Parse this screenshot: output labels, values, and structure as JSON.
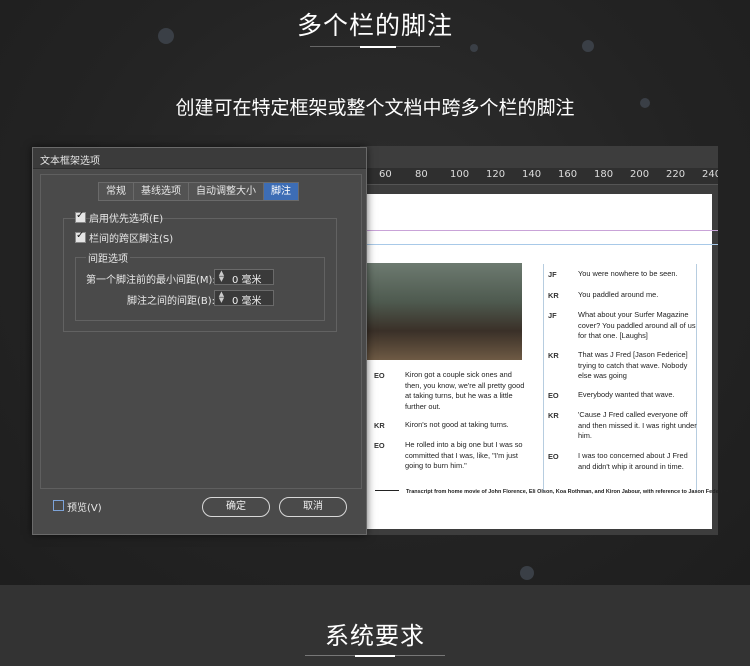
{
  "page": {
    "title": "多个栏的脚注",
    "subtitle": "创建可在特定框架或整个文档中跨多个栏的脚注",
    "section_title": "系统要求"
  },
  "ruler": {
    "ticks": [
      "60",
      "80",
      "100",
      "120",
      "140",
      "160",
      "180",
      "200",
      "220",
      "240"
    ]
  },
  "dialog": {
    "title": "文本框架选项",
    "tabs": [
      {
        "label": "常规",
        "active": false
      },
      {
        "label": "基线选项",
        "active": false
      },
      {
        "label": "自动调整大小",
        "active": false
      },
      {
        "label": "脚注",
        "active": true
      }
    ],
    "enable_override_label": "启用优先选项(E)",
    "enable_override_checked": true,
    "span_columns_label": "栏间的跨区脚注(S)",
    "span_columns_checked": true,
    "spacing_group_label": "间距选项",
    "min_space_label": "第一个脚注前的最小间距(M):",
    "min_space_value": "0 毫米",
    "space_between_label": "脚注之间的间距(B):",
    "space_between_value": "0 毫米",
    "preview_label": "预览(V)",
    "preview_checked": false,
    "ok_label": "确定",
    "cancel_label": "取消"
  },
  "document": {
    "left_column": [
      {
        "speaker": "EO",
        "text": "Kiron got a couple sick ones and then, you know, we're all pretty good at taking turns, but he was a little further out."
      },
      {
        "speaker": "KR",
        "text": "Kiron's not good at taking turns."
      },
      {
        "speaker": "EO",
        "text": "He rolled into a big one but I was so committed that I was, like, \"I'm just going to burn him.\""
      }
    ],
    "right_column": [
      {
        "speaker": "JF",
        "text": "You were nowhere to be seen."
      },
      {
        "speaker": "KR",
        "text": "You paddled around me."
      },
      {
        "speaker": "JF",
        "text": "What about your Surfer Magazine cover? You paddled around all of us for that one. [Laughs]"
      },
      {
        "speaker": "KR",
        "text": "That was J Fred [Jason Federice] trying to catch that wave. Nobody else was going"
      },
      {
        "speaker": "EO",
        "text": "Everybody wanted that wave."
      },
      {
        "speaker": "KR",
        "text": "'Cause J Fred called everyone off and then missed it. I was right under him."
      },
      {
        "speaker": "EO",
        "text": "I was too concerned about J Fred and didn't whip it around in time."
      }
    ],
    "footnote": "Transcript from home movie of John Florence, Eli Olson, Koa Rothman, and Kiron Jabour, with reference to Jason Federice."
  }
}
